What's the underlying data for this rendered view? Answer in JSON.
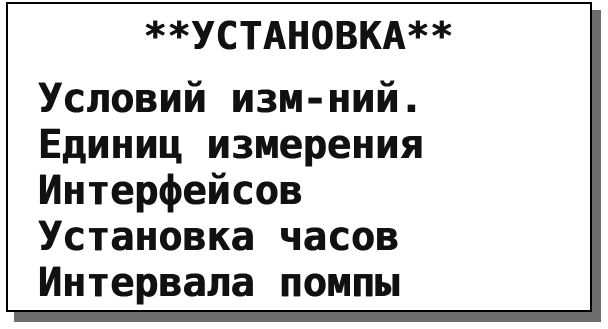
{
  "screen": {
    "title": "**УСТАНОВКА**",
    "menu_items": [
      "Условий изм-ний.",
      "Единиц измерения",
      "Интерфейсов",
      "Установка часов",
      "Интервала помпы"
    ]
  }
}
